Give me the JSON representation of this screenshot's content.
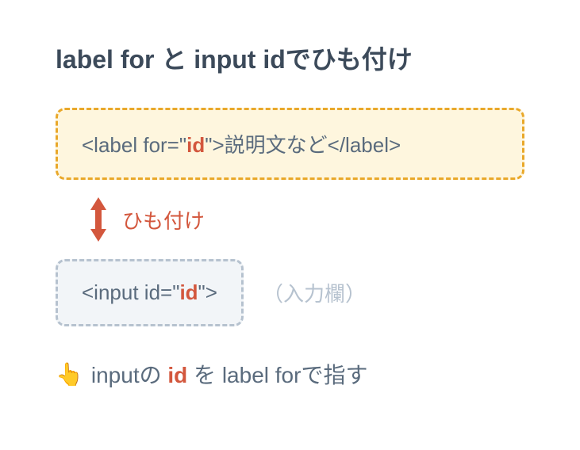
{
  "title": "label for と input idでひも付け",
  "labelBox": {
    "prefix": "<label for=\"",
    "idText": "id",
    "suffix": "\">説明文など</label>"
  },
  "connectorLabel": "ひも付け",
  "inputBox": {
    "prefix": "<input id=\"",
    "idText": "id",
    "suffix": "\">"
  },
  "inputNote": "（入力欄）",
  "footer": {
    "emoji": "👆",
    "part1": "inputの ",
    "idText": "id",
    "part2": " を label forで指す"
  },
  "colors": {
    "accent": "#d3573d",
    "labelBoxBg": "#fef6de",
    "labelBoxBorder": "#e9a82a",
    "inputBoxBg": "#f2f5f8",
    "inputBoxBorder": "#b6c2cf"
  }
}
